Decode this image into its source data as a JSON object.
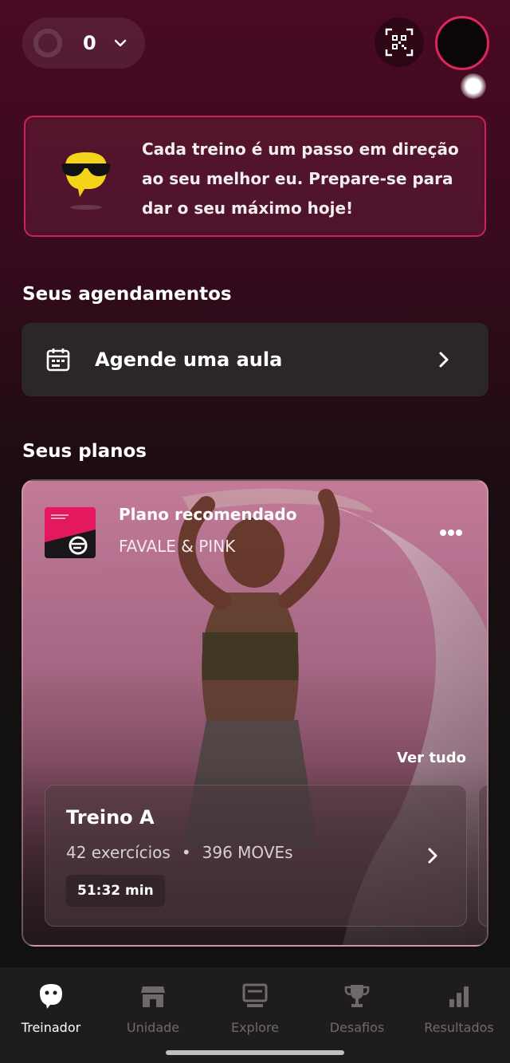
{
  "header": {
    "points_value": "0",
    "icons": [
      "chevron-down-icon",
      "qr-code-icon"
    ]
  },
  "motivation": {
    "message": "Cada treino é um passo em direção ao seu melhor eu. Prepare-se para dar o seu máximo hoje!",
    "coach_icon": "cool-face-sunglasses"
  },
  "appointments": {
    "section_title": "Seus agendamentos",
    "schedule_label": "Agende uma aula"
  },
  "plans": {
    "section_title": "Seus planos",
    "kicker": "Plano recomendado",
    "plan_name": "FAVALE & PINK",
    "see_all": "Ver tudo",
    "workout": {
      "title": "Treino A",
      "exercises": "42 exercícios",
      "separator": "•",
      "moves": "396 MOVEs",
      "duration": "51:32 min"
    }
  },
  "bottom_nav": {
    "items": [
      {
        "label": "Treinador",
        "icon": "coach-icon",
        "active": true
      },
      {
        "label": "Unidade",
        "icon": "store-icon",
        "active": false
      },
      {
        "label": "Explore",
        "icon": "monitor-icon",
        "active": false
      },
      {
        "label": "Desafios",
        "icon": "trophy-icon",
        "active": false
      },
      {
        "label": "Resultados",
        "icon": "bar-chart-icon",
        "active": false
      }
    ]
  },
  "colors": {
    "accent": "#e0245e",
    "card_dark": "#2b2729",
    "nav_bg": "#1f1c1d",
    "inactive_nav": "#6e6a6c"
  }
}
